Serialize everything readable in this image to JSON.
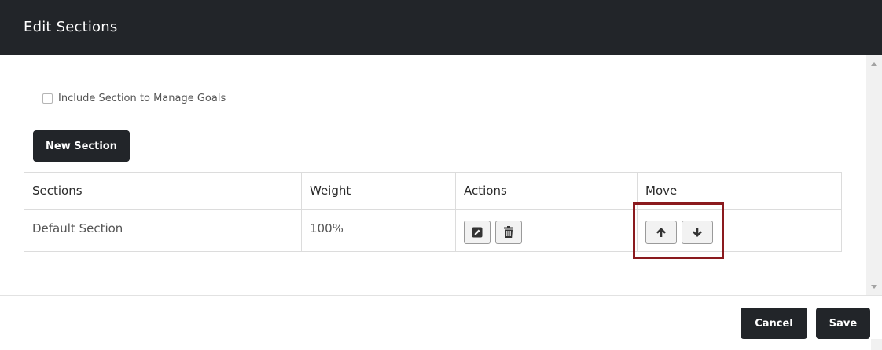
{
  "modal": {
    "title": "Edit Sections"
  },
  "options": {
    "include_goals_label": "Include Section to Manage Goals",
    "include_goals_checked": false
  },
  "toolbar": {
    "new_section_label": "New Section"
  },
  "table": {
    "headers": [
      "Sections",
      "Weight",
      "Actions",
      "Move"
    ],
    "rows": [
      {
        "section": "Default Section",
        "weight": "100%"
      }
    ]
  },
  "footer": {
    "cancel_label": "Cancel",
    "save_label": "Save"
  },
  "icons": {
    "edit": "pencil-icon",
    "delete": "trash-icon",
    "move_up": "arrow-up-icon",
    "move_down": "arrow-down-icon"
  },
  "colors": {
    "header_bg": "#222529",
    "button_bg": "#222529",
    "highlight": "#8b1a1e"
  }
}
